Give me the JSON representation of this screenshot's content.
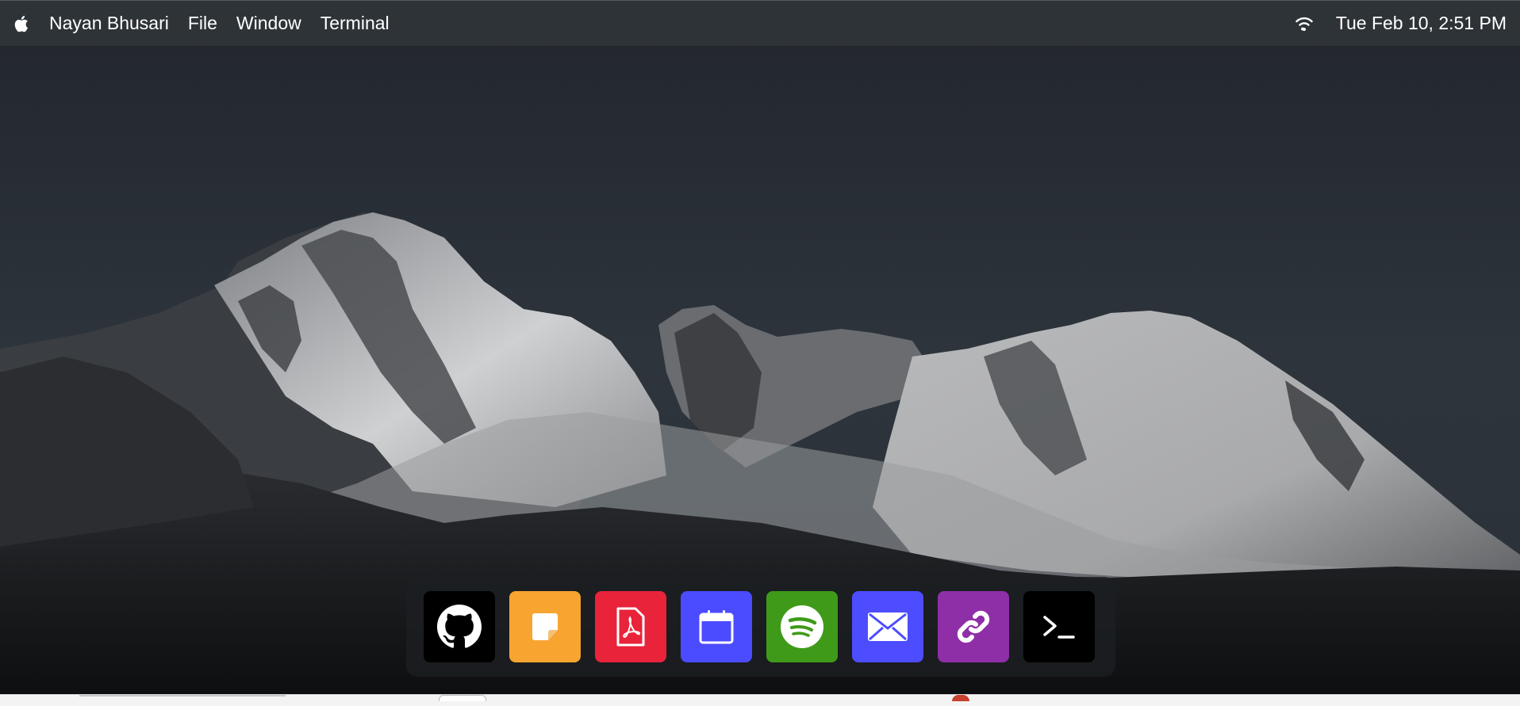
{
  "menubar": {
    "apple_icon": "apple-logo-icon",
    "items": [
      {
        "label": "Nayan Bhusari"
      },
      {
        "label": "File"
      },
      {
        "label": "Window"
      },
      {
        "label": "Terminal"
      }
    ],
    "wifi_icon": "wifi-icon",
    "clock": "Tue Feb 10, 2:51 PM"
  },
  "dock": {
    "apps": [
      {
        "icon": "github-icon",
        "color": "#000000"
      },
      {
        "icon": "notes-icon",
        "color": "#f8a431"
      },
      {
        "icon": "pdf-icon",
        "color": "#e8233a"
      },
      {
        "icon": "calendar-icon",
        "color": "#4b4bff"
      },
      {
        "icon": "spotify-icon",
        "color": "#3f9a19"
      },
      {
        "icon": "mail-icon",
        "color": "#4d4dff"
      },
      {
        "icon": "link-icon",
        "color": "#8e2fa8"
      },
      {
        "icon": "terminal-icon",
        "color": "#000000"
      }
    ]
  },
  "wallpaper": {
    "subject": "snow-covered mountains against dark sky"
  }
}
